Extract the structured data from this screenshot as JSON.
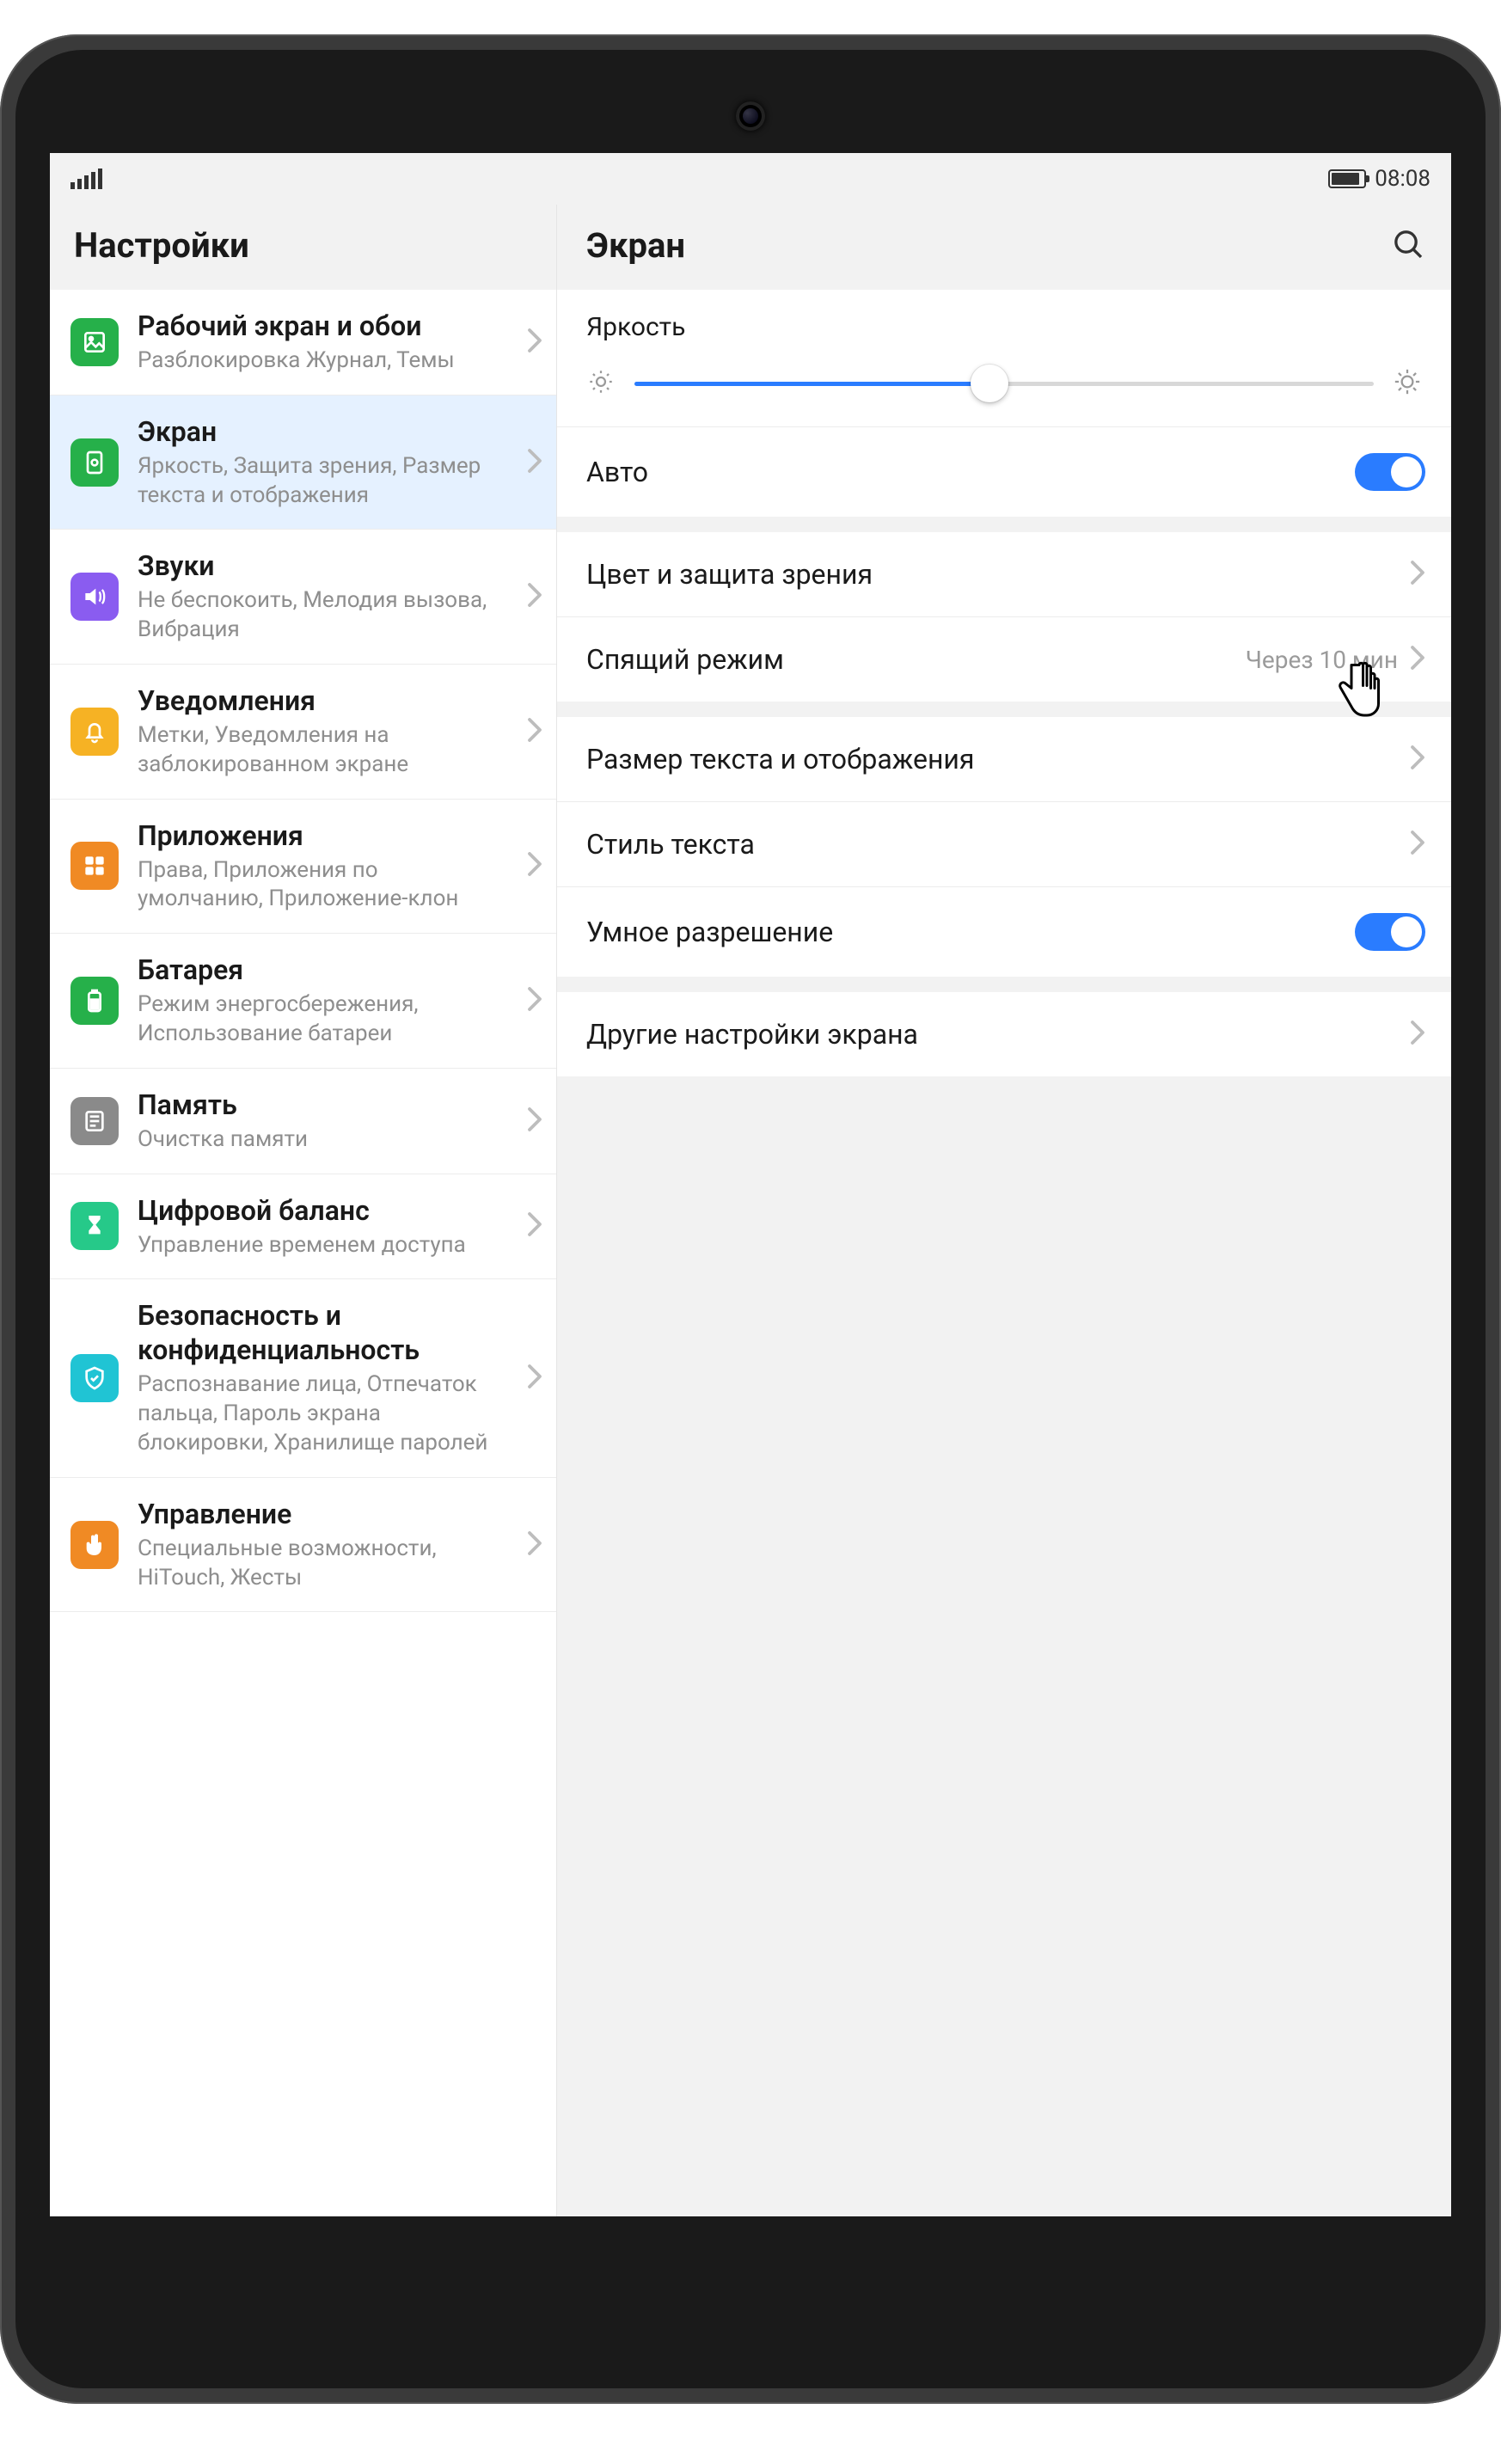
{
  "status": {
    "time": "08:08"
  },
  "sidebar": {
    "title": "Настройки",
    "items": [
      {
        "title": "Рабочий экран и обои",
        "sub": "Разблокировка Журнал, Темы",
        "icon": "wallpaper-icon",
        "color": "#26b04a"
      },
      {
        "title": "Экран",
        "sub": "Яркость, Защита зрения, Размер текста и отображения",
        "icon": "display-icon",
        "color": "#26b04a",
        "selected": true
      },
      {
        "title": "Звуки",
        "sub": "Не беспокоить, Мелодия вызова, Вибрация",
        "icon": "sound-icon",
        "color": "#8a5cf0"
      },
      {
        "title": "Уведомления",
        "sub": "Метки, Уведомления на заблокированном экране",
        "icon": "bell-icon",
        "color": "#f6b224"
      },
      {
        "title": "Приложения",
        "sub": "Права, Приложения по умолчанию, Приложение-клон",
        "icon": "apps-icon",
        "color": "#f08a24"
      },
      {
        "title": "Батарея",
        "sub": "Режим энергосбережения, Использование батареи",
        "icon": "battery-icon",
        "color": "#26b04a"
      },
      {
        "title": "Память",
        "sub": "Очистка памяти",
        "icon": "storage-icon",
        "color": "#8a8a8a"
      },
      {
        "title": "Цифровой баланс",
        "sub": "Управление временем доступа",
        "icon": "hourglass-icon",
        "color": "#26c989"
      },
      {
        "title": "Безопасность и конфиденциальность",
        "sub": "Распознавание лица, Отпечаток пальца, Пароль экрана блокировки, Хранилище паролей",
        "icon": "shield-icon",
        "color": "#20c4d4"
      },
      {
        "title": "Управление",
        "sub": "Специальные возможности, HiTouch, Жесты",
        "icon": "hand-icon",
        "color": "#f08a24"
      }
    ]
  },
  "main": {
    "title": "Экран",
    "brightness_label": "Яркость",
    "brightness_percent": 48,
    "auto_label": "Авто",
    "auto_on": true,
    "groups": [
      [
        {
          "label": "Цвет и защита зрения",
          "type": "nav"
        },
        {
          "label": "Спящий режим",
          "type": "nav",
          "value": "Через 10 мин",
          "cursor": true
        }
      ],
      [
        {
          "label": "Размер текста и отображения",
          "type": "nav"
        },
        {
          "label": "Стиль текста",
          "type": "nav"
        },
        {
          "label": "Умное разрешение",
          "type": "toggle",
          "on": true
        }
      ],
      [
        {
          "label": "Другие настройки экрана",
          "type": "nav"
        }
      ]
    ]
  }
}
